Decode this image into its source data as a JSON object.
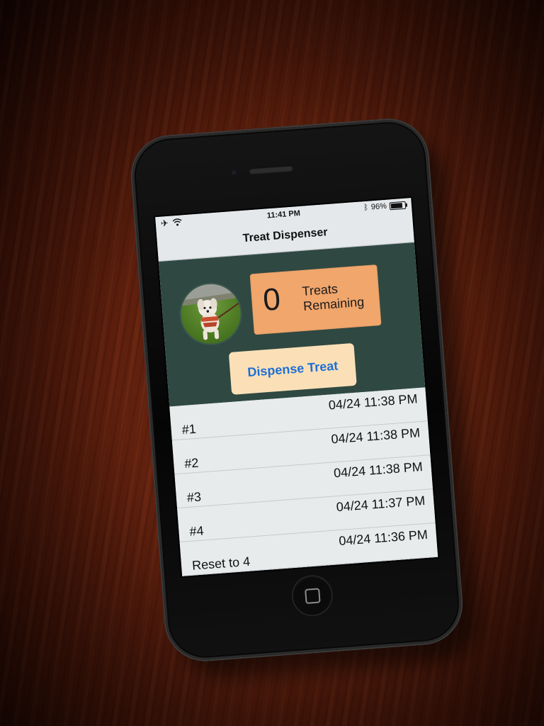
{
  "status_bar": {
    "airplane_icon": "airplane-icon",
    "wifi_icon": "wifi-icon",
    "time": "11:41 PM",
    "bluetooth_icon": "bluetooth-icon",
    "battery_percent": "96%",
    "battery_level": 0.96
  },
  "nav": {
    "title": "Treat Dispenser"
  },
  "header": {
    "avatar_icon": "dog-photo",
    "treat_count": "0",
    "treat_label_line1": "Treats",
    "treat_label_line2": "Remaining",
    "dispense_button_label": "Dispense Treat"
  },
  "history": [
    {
      "label": "#1",
      "time": "04/24 11:38 PM"
    },
    {
      "label": "#2",
      "time": "04/24 11:38 PM"
    },
    {
      "label": "#3",
      "time": "04/24 11:38 PM"
    },
    {
      "label": "#4",
      "time": "04/24 11:37 PM"
    },
    {
      "label": "Reset to 4",
      "time": "04/24 11:36 PM"
    }
  ],
  "colors": {
    "header_background": "#2f4842",
    "counter_background": "#f1a66c",
    "button_background": "#fbe0b7",
    "button_text": "#1d6fd6",
    "table_background": "#e7ebec"
  }
}
